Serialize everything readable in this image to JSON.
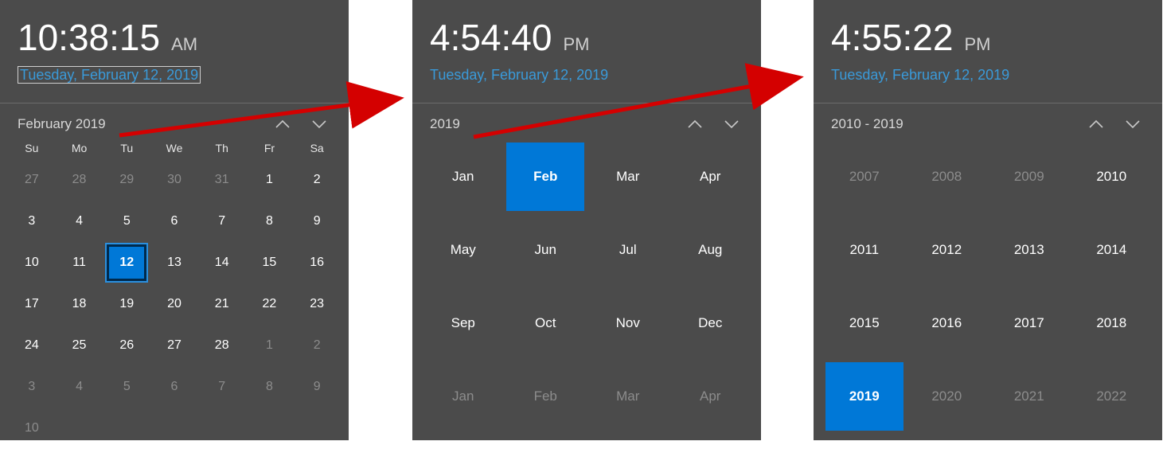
{
  "colors": {
    "accent": "#0078d7",
    "link": "#3a9ad9",
    "panel_bg": "#4b4b4b"
  },
  "panels": {
    "days": {
      "time": "10:38:15",
      "ampm": "AM",
      "date": "Tuesday, February 12, 2019",
      "header": "February 2019",
      "weekdays": [
        "Su",
        "Mo",
        "Tu",
        "We",
        "Th",
        "Fr",
        "Sa"
      ],
      "grid": [
        {
          "n": "27",
          "muted": true
        },
        {
          "n": "28",
          "muted": true
        },
        {
          "n": "29",
          "muted": true
        },
        {
          "n": "30",
          "muted": true
        },
        {
          "n": "31",
          "muted": true
        },
        {
          "n": "1"
        },
        {
          "n": "2"
        },
        {
          "n": "3"
        },
        {
          "n": "4"
        },
        {
          "n": "5"
        },
        {
          "n": "6"
        },
        {
          "n": "7"
        },
        {
          "n": "8"
        },
        {
          "n": "9"
        },
        {
          "n": "10"
        },
        {
          "n": "11"
        },
        {
          "n": "12",
          "selected": true
        },
        {
          "n": "13"
        },
        {
          "n": "14"
        },
        {
          "n": "15"
        },
        {
          "n": "16"
        },
        {
          "n": "17"
        },
        {
          "n": "18"
        },
        {
          "n": "19"
        },
        {
          "n": "20"
        },
        {
          "n": "21"
        },
        {
          "n": "22"
        },
        {
          "n": "23"
        },
        {
          "n": "24"
        },
        {
          "n": "25"
        },
        {
          "n": "26"
        },
        {
          "n": "27"
        },
        {
          "n": "28"
        },
        {
          "n": "1",
          "muted": true
        },
        {
          "n": "2",
          "muted": true
        },
        {
          "n": "3",
          "muted": true
        },
        {
          "n": "4",
          "muted": true
        },
        {
          "n": "5",
          "muted": true
        },
        {
          "n": "6",
          "muted": true
        },
        {
          "n": "7",
          "muted": true
        },
        {
          "n": "8",
          "muted": true
        },
        {
          "n": "9",
          "muted": true
        },
        {
          "n": "10",
          "muted": true
        }
      ]
    },
    "months": {
      "time": "4:54:40",
      "ampm": "PM",
      "date": "Tuesday, February 12, 2019",
      "header": "2019",
      "grid": [
        {
          "m": "Jan"
        },
        {
          "m": "Feb",
          "selected": true
        },
        {
          "m": "Mar"
        },
        {
          "m": "Apr"
        },
        {
          "m": "May"
        },
        {
          "m": "Jun"
        },
        {
          "m": "Jul"
        },
        {
          "m": "Aug"
        },
        {
          "m": "Sep"
        },
        {
          "m": "Oct"
        },
        {
          "m": "Nov"
        },
        {
          "m": "Dec"
        },
        {
          "m": "Jan",
          "muted": true
        },
        {
          "m": "Feb",
          "muted": true
        },
        {
          "m": "Mar",
          "muted": true
        },
        {
          "m": "Apr",
          "muted": true
        }
      ]
    },
    "years": {
      "time": "4:55:22",
      "ampm": "PM",
      "date": "Tuesday, February 12, 2019",
      "header": "2010 - 2019",
      "grid": [
        {
          "y": "2007",
          "muted": true
        },
        {
          "y": "2008",
          "muted": true
        },
        {
          "y": "2009",
          "muted": true
        },
        {
          "y": "2010"
        },
        {
          "y": "2011"
        },
        {
          "y": "2012"
        },
        {
          "y": "2013"
        },
        {
          "y": "2014"
        },
        {
          "y": "2015"
        },
        {
          "y": "2016"
        },
        {
          "y": "2017"
        },
        {
          "y": "2018"
        },
        {
          "y": "2019",
          "selected": true
        },
        {
          "y": "2020",
          "muted": true
        },
        {
          "y": "2021",
          "muted": true
        },
        {
          "y": "2022",
          "muted": true
        }
      ]
    }
  }
}
